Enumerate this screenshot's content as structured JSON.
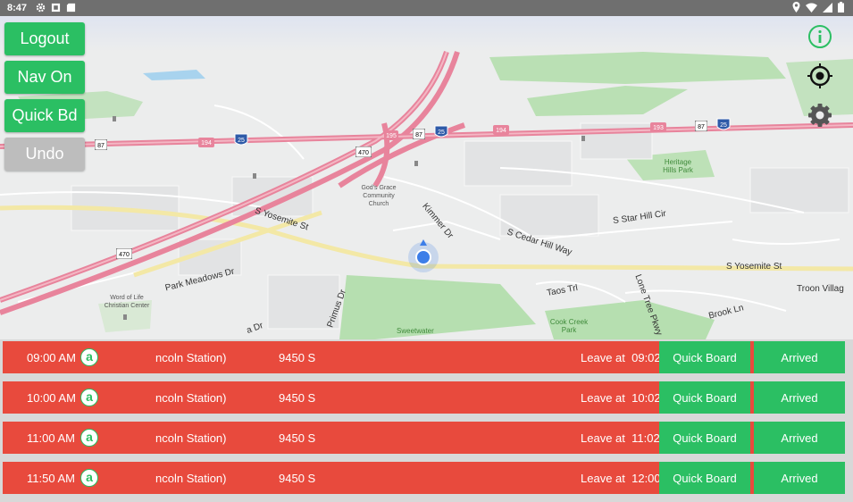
{
  "status_bar": {
    "time": "8:47",
    "left_icons": [
      "gear-icon",
      "sim-icon",
      "sd-card-icon"
    ],
    "right_icons": [
      "location-icon",
      "wifi-icon",
      "signal-icon",
      "battery-icon"
    ]
  },
  "controls": {
    "logout_label": "Logout",
    "nav_label": "Nav On",
    "quick_board_label": "Quick Bd",
    "undo_label": "Undo",
    "right_icons": [
      "info-icon",
      "locate-target-icon",
      "settings-gear-icon"
    ]
  },
  "map": {
    "labels": {
      "yosemite_west": "S Yosemite St",
      "yosemite_east": "S Yosemite St",
      "park_meadows": "Park Meadows Dr",
      "kimmer": "Kimmer Dr",
      "cedar_hill": "S Cedar Hill Way",
      "star_hill": "S Star Hill Cir",
      "taos": "Taos Trl",
      "brook": "Brook Ln",
      "troon": "Troon Villag",
      "lone_tree": "Lone Tree Pkwy",
      "gods_grace": "God's Grace Community Church",
      "word_of_life": "Word of Life Christian Center",
      "heritage": "Heritage Hills Park",
      "cook_creek": "Cook Creek Park",
      "sweetwater": "Sweetwater",
      "primus": "Primus Dr",
      "pa_dr": "a Dr"
    },
    "shields": [
      "87",
      "194",
      "25",
      "195",
      "87",
      "25",
      "194",
      "193",
      "87",
      "25",
      "470",
      "470"
    ]
  },
  "trips": [
    {
      "time": "09:00 AM",
      "badge": "a",
      "station": "ncoln Station)",
      "address": "9450 S",
      "leave_prefix": "Leave at",
      "leave_time": "09:02",
      "quick_board": "Quick Board",
      "arrived": "Arrived"
    },
    {
      "time": "10:00 AM",
      "badge": "a",
      "station": "ncoln Station)",
      "address": "9450 S",
      "leave_prefix": "Leave at",
      "leave_time": "10:02",
      "quick_board": "Quick Board",
      "arrived": "Arrived"
    },
    {
      "time": "11:00 AM",
      "badge": "a",
      "station": "ncoln Station)",
      "address": "9450 S",
      "leave_prefix": "Leave at",
      "leave_time": "11:02",
      "quick_board": "Quick Board",
      "arrived": "Arrived"
    },
    {
      "time": "11:50 AM",
      "badge": "a",
      "station": "ncoln Station)",
      "address": "9450 S",
      "leave_prefix": "Leave at",
      "leave_time": "12:00",
      "quick_board": "Quick Board",
      "arrived": "Arrived"
    }
  ],
  "colors": {
    "accent_green": "#2bbf63",
    "row_red": "#e84a3d",
    "highway_pink": "#e8849c",
    "location_blue": "#3d7ee8"
  }
}
